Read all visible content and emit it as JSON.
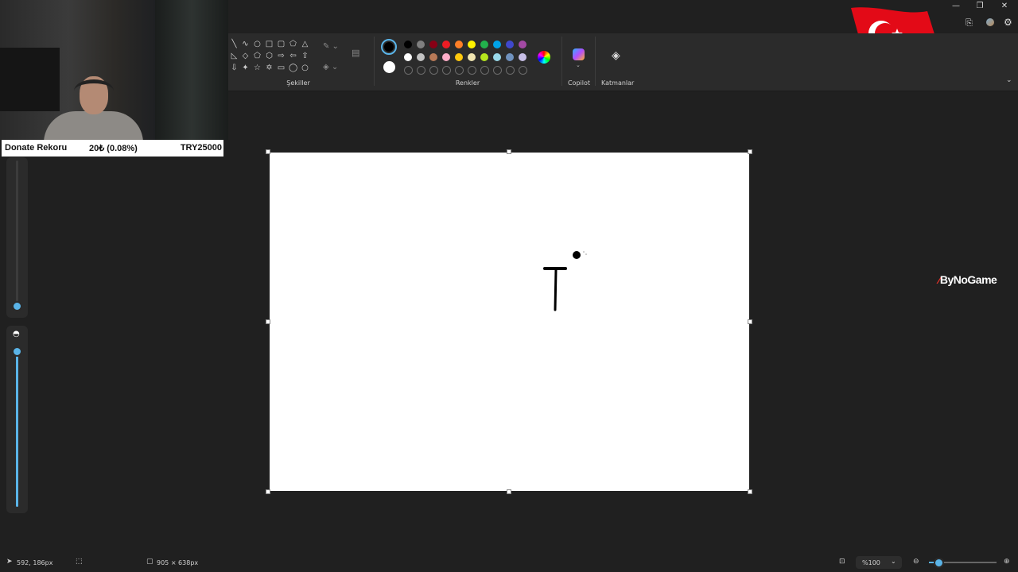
{
  "window": {
    "minimize_glyph": "—",
    "maximize_glyph": "❐",
    "close_glyph": "✕"
  },
  "ribbon": {
    "shapes_label": "Şekiller",
    "colors_label": "Renkler",
    "copilot_label": "Copilot",
    "layers_label": "Katmanlar"
  },
  "palette": {
    "row1": [
      "#000000",
      "#7f7f7f",
      "#880015",
      "#ed1c24",
      "#ff7f27",
      "#fff200",
      "#22b14c",
      "#00a2e8",
      "#3f48cc",
      "#a349a4"
    ],
    "row2": [
      "#ffffff",
      "#c3c3c3",
      "#b97a57",
      "#ffaec9",
      "#ffc90e",
      "#efe4b0",
      "#b5e61d",
      "#99d9ea",
      "#7092be",
      "#c8bfe7"
    ],
    "primary": "#000000",
    "secondary": "#ffffff",
    "accent": "#5ab4e8"
  },
  "overlay": {
    "donate_label": "Donate Rekoru",
    "donate_amount": "20₺ (0.08%)",
    "donate_goal": "TRY25000",
    "sponsor": "ByNoGame"
  },
  "status": {
    "cursor_pos": "592, 186px",
    "canvas_size": "905 × 638px",
    "zoom": "%100"
  },
  "sliders": {
    "size_level": 0.0,
    "opacity_level": 1.0
  }
}
